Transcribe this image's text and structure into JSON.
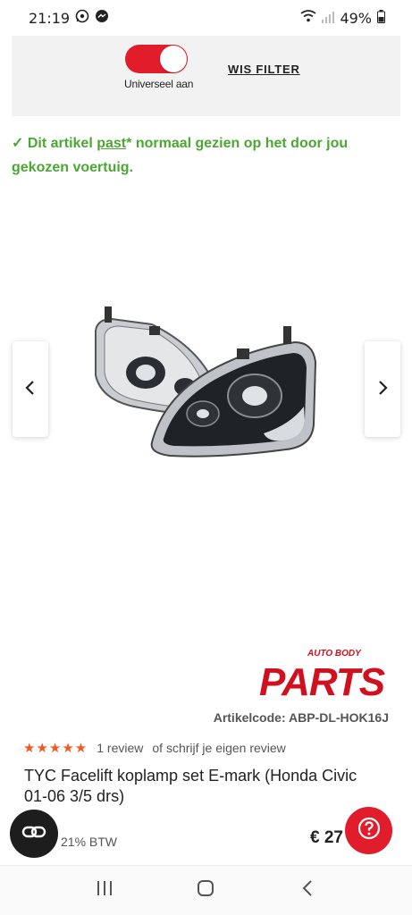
{
  "status": {
    "time": "21:19",
    "battery": "49%",
    "icons": [
      "whatsapp-icon",
      "messenger-icon",
      "wifi-icon",
      "signal-icon",
      "battery-icon"
    ]
  },
  "filter": {
    "toggle_label": "Universeel aan",
    "toggle_on": true,
    "clear_label": "WIS FILTER"
  },
  "fit_message": {
    "check": "✓",
    "prefix": "Dit artikel",
    "link": "past",
    "suffix": "* normaal gezien op het door jou gekozen voertuig."
  },
  "gallery": {
    "prev_icon": "‹",
    "next_icon": "›"
  },
  "brand": {
    "top_text": "AUTO BODY",
    "main_text": "PARTS"
  },
  "product": {
    "article_code": "Artikelcode: ABP-DL-HOK16J",
    "stars": "★★★★★",
    "review_count": "1 review",
    "review_link": "of schrijf je eigen review",
    "title": "TYC Facelift koplamp set E-mark (Honda Civic 01-06 3/5 drs)",
    "btw": "21% BTW",
    "price": "€ 27"
  },
  "colors": {
    "accent_red": "#e11d2b",
    "success_green": "#4aa832",
    "star_orange": "#f05a22"
  }
}
